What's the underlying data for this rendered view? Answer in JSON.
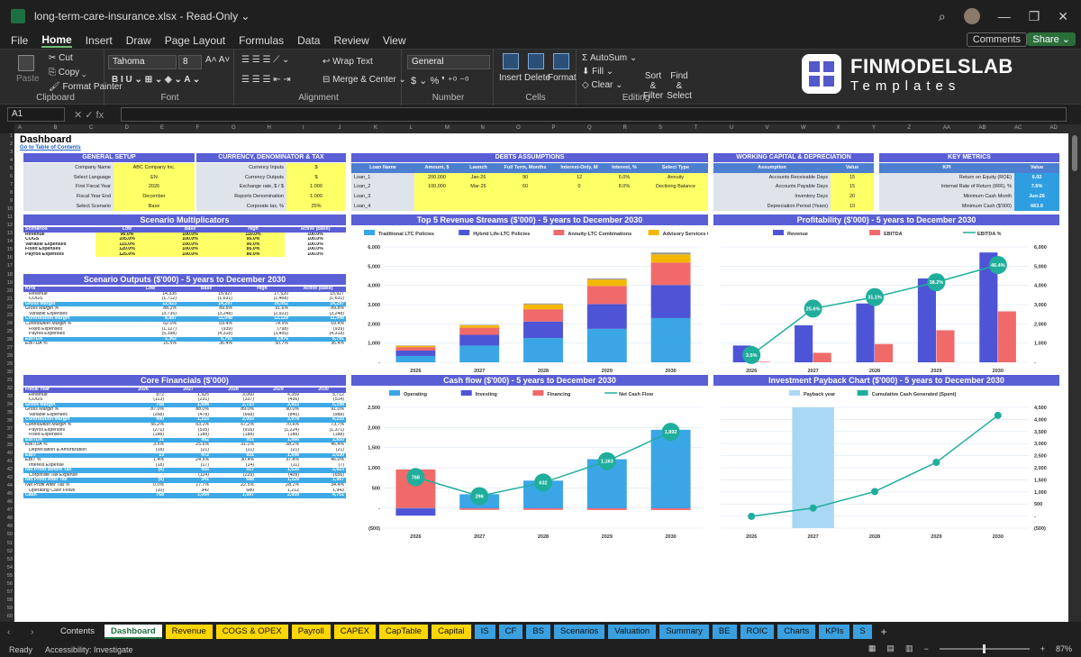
{
  "window": {
    "title": "long-term-care-insurance.xlsx  -  Read-Only ⌄"
  },
  "menu": {
    "tabs": [
      "File",
      "Home",
      "Insert",
      "Draw",
      "Page Layout",
      "Formulas",
      "Data",
      "Review",
      "View"
    ],
    "comments": "Comments",
    "share": "Share ⌄"
  },
  "ribbon": {
    "paste": "Paste",
    "cut": "Cut",
    "copy": "Copy",
    "format_painter": "Format Painter",
    "clipboard": "Clipboard",
    "font_name": "Tahoma",
    "font_size": "8",
    "font": "Font",
    "wrap_text": "Wrap Text",
    "merge_center": "Merge & Center",
    "alignment": "Alignment",
    "number_format": "General",
    "number": "Number",
    "insert": "Insert",
    "delete": "Delete",
    "format": "Format",
    "cells": "Cells",
    "autosum": "AutoSum",
    "fill": "Fill",
    "clear": "Clear",
    "sort_filter": "Sort & Filter",
    "find_select": "Find & Select",
    "editing": "Editing"
  },
  "logo": {
    "line1": "FINMODELSLAB",
    "line2": "Templates"
  },
  "formula_bar": {
    "cell_ref": "A1",
    "icons": "✕  ✓  fx"
  },
  "sheet": {
    "title": "Dashboard",
    "toc_link": "Go to Table of Contents",
    "general_setup": {
      "header": "GENERAL SETUP",
      "rows": [
        [
          "Company Name",
          "ABC Company Inc."
        ],
        [
          "Select Language",
          "EN"
        ],
        [
          "First Fiscal Year",
          "2026"
        ],
        [
          "Fiscal Year End",
          "December"
        ],
        [
          "Select Scenario",
          "Base"
        ]
      ]
    },
    "currency": {
      "header": "CURRENCY, DENOMINATOR & TAX",
      "rows": [
        [
          "Currency Inputs",
          "$"
        ],
        [
          "Currency Outputs",
          "$"
        ],
        [
          "Exchange rate, $ / $",
          "1.000"
        ],
        [
          "Reports Denomination",
          "1,000"
        ],
        [
          "Corporate tax, %",
          "25%"
        ]
      ]
    },
    "debts": {
      "header": "DEBTS ASSUMPTIONS",
      "cols": [
        "Loan Name",
        "Amount, $",
        "Launch",
        "Full Term, Months",
        "Interest-Only, M",
        "Interest, %",
        "Select Type"
      ],
      "rows": [
        [
          "Loan_1",
          "200,000",
          "Jan-26",
          "90",
          "12",
          "6.0%",
          "Annuity"
        ],
        [
          "Loan_2",
          "100,000",
          "Mar-26",
          "60",
          "0",
          "8.0%",
          "Declining Balance"
        ],
        [
          "Loan_3",
          "",
          "",
          "",
          "",
          "",
          ""
        ],
        [
          "Loan_4",
          "",
          "",
          "",
          "",
          "",
          ""
        ]
      ]
    },
    "working_capital": {
      "header": "WORKING CAPITAL & DEPRECIATION",
      "cols": [
        "Assumption",
        "Value"
      ],
      "rows": [
        [
          "Accounts Receivable Days",
          "15"
        ],
        [
          "Accounts Payable Days",
          "15"
        ],
        [
          "Inventory Days",
          "20"
        ],
        [
          "Depreciation Period (Years)",
          "10"
        ]
      ]
    },
    "key_metrics": {
      "header": "KEY METRICS",
      "cols": [
        "KPI",
        "Value"
      ],
      "rows": [
        [
          "Return on Equity (ROE)",
          "6.02"
        ],
        [
          "Internal Rate of Return (IRR), %",
          "7.6%"
        ],
        [
          "Minimum Cash Month",
          "Jun-26"
        ],
        [
          "Minimum Cash ($'000)",
          "663.0"
        ]
      ]
    },
    "scenario_multipliers": {
      "title": "Scenario Multiplicators",
      "cols": [
        "Scenarios",
        "Low",
        "Base",
        "High",
        "Active (Base)"
      ],
      "rows": [
        [
          "Revenue",
          "90.0%",
          "100.0%",
          "110.0%",
          "100.0%"
        ],
        [
          "COGS",
          "105.0%",
          "100.0%",
          "95.0%",
          "100.0%"
        ],
        [
          "Variable Expenses",
          "115.0%",
          "100.0%",
          "90.0%",
          "100.0%"
        ],
        [
          "Fixed Expenses",
          "120.0%",
          "100.0%",
          "85.0%",
          "100.0%"
        ],
        [
          "Payroll Expenses",
          "125.0%",
          "100.0%",
          "80.0%",
          "100.0%"
        ]
      ]
    },
    "scenario_outputs": {
      "title": "Scenario Outputs ($'000) - 5 years to December 2030",
      "cols": [
        "KPIs",
        "Low",
        "Base",
        "High",
        "Active (Base)"
      ],
      "rows": [
        {
          "k": "Revenue",
          "v": [
            "14,335",
            "15,927",
            "17,520",
            "15,927"
          ],
          "s": ""
        },
        {
          "k": "COGS",
          "v": [
            "(1,712)",
            "(1,631)",
            "(1,468)",
            "(1,631)"
          ],
          "s": ""
        },
        {
          "k": "Gross Margin",
          "v": [
            "12,623",
            "14,297",
            "16,052",
            "14,297"
          ],
          "s": "hl"
        },
        {
          "k": "Gross Margin %",
          "v": [
            "88.1%",
            "89.8%",
            "91.6%",
            "89.8%"
          ],
          "s": "it"
        },
        {
          "k": "Variable Expenses",
          "v": [
            "(3,735)",
            "(3,248)",
            "(2,923)",
            "(3,248)"
          ],
          "s": ""
        },
        {
          "k": "Contribution Margin",
          "v": [
            "8,887",
            "11,048",
            "13,129",
            "11,048"
          ],
          "s": "hl"
        },
        {
          "k": "Contribution Margin %",
          "v": [
            "62.0%",
            "69.4%",
            "74.9%",
            "69.4%"
          ],
          "s": "it"
        },
        {
          "k": "Fixed Expenses",
          "v": [
            "(1,127)",
            "(939)",
            "(798)",
            "(939)"
          ],
          "s": ""
        },
        {
          "k": "Payroll Expenses",
          "v": [
            "(5,398)",
            "(4,318)",
            "(3,455)",
            "(4,318)"
          ],
          "s": ""
        },
        {
          "k": "EBITDA",
          "v": [
            "2,362",
            "5,791",
            "8,876",
            "5,791"
          ],
          "s": "hl"
        },
        {
          "k": "EBITDA %",
          "v": [
            "16.5%",
            "36.4%",
            "50.7%",
            "36.4%"
          ],
          "s": "it"
        }
      ]
    },
    "core_financials": {
      "title": "Core Financials ($'000)",
      "cols": [
        "Fiscal Year",
        "2026",
        "2027",
        "2028",
        "2029",
        "2030"
      ],
      "rows": [
        {
          "k": "Revenue",
          "v": [
            "872",
            "1,925",
            "3,060",
            "4,359",
            "5,712"
          ],
          "s": ""
        },
        {
          "k": "COGS",
          "v": [
            "(113)",
            "(231)",
            "(337)",
            "(436)",
            "(514)"
          ],
          "s": ""
        },
        {
          "k": "Gross Margin",
          "v": [
            "758",
            "1,694",
            "2,723",
            "3,923",
            "5,198"
          ],
          "s": "hl"
        },
        {
          "k": "Gross Margin %",
          "v": [
            "87.0%",
            "88.0%",
            "89.0%",
            "90.0%",
            "91.0%"
          ],
          "s": "it"
        },
        {
          "k": "Variable Expenses",
          "v": [
            "(268)",
            "(478)",
            "(668)",
            "(845)",
            "(988)"
          ],
          "s": ""
        },
        {
          "k": "Contribution Margin",
          "v": [
            "490",
            "1,215",
            "2,055",
            "3,078",
            "4,210"
          ],
          "s": "hl"
        },
        {
          "k": "Contribution Margin %",
          "v": [
            "56.2%",
            "63.1%",
            "67.2%",
            "70.6%",
            "73.7%"
          ],
          "s": "it"
        },
        {
          "k": "Payroll Expenses",
          "v": [
            "(271)",
            "(535)",
            "(916)",
            "(1,224)",
            "(1,371)"
          ],
          "s": ""
        },
        {
          "k": "Fixed Expenses",
          "v": [
            "(188)",
            "(188)",
            "(188)",
            "(188)",
            "(188)"
          ],
          "s": ""
        },
        {
          "k": "EBITDA",
          "v": [
            "31",
            "492",
            "951",
            "1,666",
            "2,650"
          ],
          "s": "hl"
        },
        {
          "k": "EBITDA %",
          "v": [
            "3.5%",
            "25.6%",
            "31.1%",
            "38.2%",
            "46.4%"
          ],
          "s": "it"
        },
        {
          "k": "Depreciation & Amortization",
          "v": [
            "(18)",
            "(21)",
            "(21)",
            "(21)",
            "(21)"
          ],
          "s": ""
        },
        {
          "k": "EBIT",
          "v": [
            "13",
            "472",
            "931",
            "1,646",
            "2,630"
          ],
          "s": "hl"
        },
        {
          "k": "EBIT %",
          "v": [
            "1.4%",
            "24.5%",
            "30.4%",
            "37.8%",
            "46.0%"
          ],
          "s": "it"
        },
        {
          "k": "Interest Expense",
          "v": [
            "(18)",
            "(17)",
            "(14)",
            "(11)",
            "(7)"
          ],
          "s": ""
        },
        {
          "k": "Net Profit Before Tax",
          "v": [
            "(6)",
            "455",
            "917",
            "1,635",
            "2,623"
          ],
          "s": "hl"
        },
        {
          "k": "Corporate Tax Expense",
          "v": [
            "-",
            "(114)",
            "(229)",
            "(409)",
            "(656)"
          ],
          "s": ""
        },
        {
          "k": "Net Profit After Tax",
          "v": [
            "(6)",
            "341",
            "688",
            "1,226",
            "1,967"
          ],
          "s": "hl"
        },
        {
          "k": "Net Profit After Tax %",
          "v": [
            "0.0%",
            "17.7%",
            "22.5%",
            "28.1%",
            "34.4%"
          ],
          "s": "it"
        },
        {
          "k": "Operating Cash Flows",
          "v": [
            "(10)",
            "342",
            "680",
            "1,212",
            "1,943"
          ],
          "s": ""
        },
        {
          "k": "Cash",
          "v": [
            "768",
            "1,064",
            "1,697",
            "2,859",
            "4,751"
          ],
          "s": "hl"
        }
      ]
    }
  },
  "chart_titles": {
    "revenue": "Top 5 Revenue Streams ($'000) - 5 years to December 2030",
    "profit": "Profitability ($'000) - 5 years to December 2030",
    "cash": "Cash flow ($'000) - 5 years to December 2030",
    "payback": "Investment Payback Chart ($'000) - 5 years to December 2030"
  },
  "chart_data": [
    {
      "type": "bar",
      "stacked": true,
      "title": "Top 5 Revenue Streams ($'000) - 5 years to December 2030",
      "categories": [
        "2026",
        "2027",
        "2028",
        "2029",
        "2030"
      ],
      "ylim": [
        0,
        6000
      ],
      "yticks": [
        "-",
        "1,000",
        "2,000",
        "3,000",
        "4,000",
        "5,000",
        "6,000"
      ],
      "series": [
        {
          "name": "Traditional LTC Policies",
          "color": "#3aa6e6",
          "values": [
            330,
            870,
            1260,
            1740,
            2300
          ]
        },
        {
          "name": "Hybrid Life-LTC Policies",
          "color": "#4d55d6",
          "values": [
            280,
            560,
            860,
            1290,
            1720
          ]
        },
        {
          "name": "Annuity-LTC Combinations",
          "color": "#f06a6a",
          "values": [
            180,
            370,
            640,
            940,
            1170
          ]
        },
        {
          "name": "Advisory Services Only",
          "color": "#f5b800",
          "values": [
            70,
            120,
            250,
            330,
            420
          ]
        },
        {
          "name": "Other Revenue",
          "color": "#999999",
          "values": [
            12,
            25,
            50,
            59,
            102
          ]
        }
      ]
    },
    {
      "type": "bar",
      "title": "Profitability ($'000) - 5 years to December 2030",
      "categories": [
        "2026",
        "2027",
        "2028",
        "2029",
        "2030"
      ],
      "ylim": [
        0,
        6000
      ],
      "yticks": [
        "-",
        "1,000",
        "2,000",
        "3,000",
        "4,000",
        "5,000",
        "6,000"
      ],
      "series": [
        {
          "name": "Revenue",
          "color": "#4d55d6",
          "values": [
            872,
            1925,
            3060,
            4359,
            5712
          ]
        },
        {
          "name": "EBITDA",
          "color": "#f06a6a",
          "values": [
            31,
            492,
            951,
            1666,
            2650
          ]
        },
        {
          "name": "EBITDA %",
          "color": "#1fae9b",
          "type": "line",
          "labels": [
            "3.5%",
            "25.6%",
            "31.1%",
            "38.2%",
            "46.4%"
          ],
          "values": [
            3.5,
            25.6,
            31.1,
            38.2,
            46.4
          ]
        }
      ]
    },
    {
      "type": "bar",
      "stacked": true,
      "title": "Cash flow ($'000) - 5 years to December 2030",
      "categories": [
        "2026",
        "2027",
        "2028",
        "2029",
        "2030"
      ],
      "ylim": [
        -500,
        2500
      ],
      "yticks": [
        "(500)",
        "-",
        "500",
        "1,000",
        "1,500",
        "2,000",
        "2,500"
      ],
      "series": [
        {
          "name": "Operating",
          "color": "#3aa6e6",
          "values": [
            -10,
            342,
            680,
            1212,
            1943
          ]
        },
        {
          "name": "Investing",
          "color": "#4d55d6",
          "values": [
            -180,
            -10,
            -10,
            -10,
            -10
          ]
        },
        {
          "name": "Financing",
          "color": "#f06a6a",
          "values": [
            958,
            -36,
            -37,
            -40,
            -41
          ]
        },
        {
          "name": "Net Cash Flow",
          "color": "#1fae9b",
          "type": "line",
          "labels": [
            "768",
            "296",
            "632",
            "1,163",
            "1,892"
          ],
          "values": [
            768,
            296,
            632,
            1163,
            1892
          ]
        }
      ]
    },
    {
      "type": "line",
      "title": "Investment Payback Chart ($'000) - 5 years to December 2030",
      "categories": [
        "2026",
        "2027",
        "2028",
        "2029",
        "2030"
      ],
      "ylim": [
        -500,
        4500
      ],
      "yticks": [
        "(500)",
        "-",
        "500",
        "1,000",
        "1,500",
        "2,000",
        "2,500",
        "3,000",
        "3,500",
        "4,000",
        "4,500"
      ],
      "series": [
        {
          "name": "Payback year",
          "color": "#a9d8f5",
          "type": "column",
          "values": [
            0,
            4500,
            0,
            0,
            0
          ]
        },
        {
          "name": "Cumulative Cash Generated (Spent)",
          "color": "#1fae9b",
          "values": [
            -10,
            332,
            1012,
            2224,
            4167
          ]
        }
      ]
    }
  ],
  "sheet_tabs": [
    {
      "name": "Contents",
      "style": "plain"
    },
    {
      "name": "Dashboard",
      "style": "active"
    },
    {
      "name": "Revenue",
      "style": "yel"
    },
    {
      "name": "COGS & OPEX",
      "style": "yel"
    },
    {
      "name": "Payroll",
      "style": "yel"
    },
    {
      "name": "CAPEX",
      "style": "yel"
    },
    {
      "name": "CapTable",
      "style": "yel"
    },
    {
      "name": "Capital",
      "style": "yel"
    },
    {
      "name": "IS",
      "style": "blue"
    },
    {
      "name": "CF",
      "style": "blue"
    },
    {
      "name": "BS",
      "style": "blue"
    },
    {
      "name": "Scenarios",
      "style": "blue"
    },
    {
      "name": "Valuation",
      "style": "blue"
    },
    {
      "name": "Summary",
      "style": "blue"
    },
    {
      "name": "BE",
      "style": "blue"
    },
    {
      "name": "ROIC",
      "style": "blue"
    },
    {
      "name": "Charts",
      "style": "blue"
    },
    {
      "name": "KPIs",
      "style": "blue"
    },
    {
      "name": "S",
      "style": "blue"
    }
  ],
  "status": {
    "ready": "Ready",
    "accessibility": "Accessibility: Investigate",
    "zoom": "87%"
  }
}
